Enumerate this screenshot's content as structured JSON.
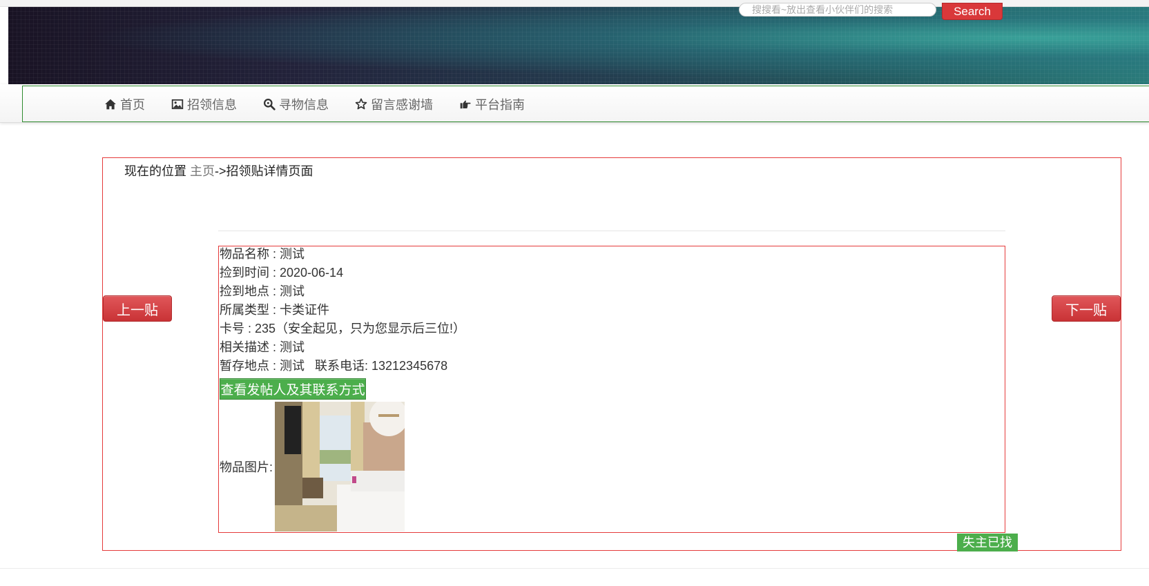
{
  "header": {
    "search_placeholder": "搜搜看~放出查看小伙伴们的搜索",
    "search_button": "Search"
  },
  "nav": {
    "items": [
      {
        "label": "首页",
        "icon": "home-icon"
      },
      {
        "label": "招领信息",
        "icon": "picture-icon"
      },
      {
        "label": "寻物信息",
        "icon": "zoom-search-icon"
      },
      {
        "label": "留言感谢墙",
        "icon": "star-icon"
      },
      {
        "label": "平台指南",
        "icon": "hand-point-right-icon"
      }
    ]
  },
  "breadcrumb": {
    "prefix": "现在的位置",
    "home": "主页",
    "current": "->招领贴详情页面"
  },
  "pager": {
    "prev": "上一贴",
    "next": "下一贴"
  },
  "detail": {
    "name": "物品名称 : 测试",
    "time": "捡到时间 : 2020-06-14",
    "place": "捡到地点 : 测试",
    "type": "所属类型 : 卡类证件",
    "card": "卡号 : 235（安全起见，只为您显示后三位!）",
    "desc": "相关描述 : 测试",
    "storage": "暂存地点 : 测试   联系电话: 13212345678",
    "contact_button": "查看发帖人及其联系方式",
    "image_label": "物品图片:",
    "found_badge": "失主已找到"
  },
  "colors": {
    "accent_red": "#d9383a",
    "accent_green": "#4cae4c",
    "frame_red": "#e53a3a",
    "nav_border_green": "#2e8b2e"
  }
}
